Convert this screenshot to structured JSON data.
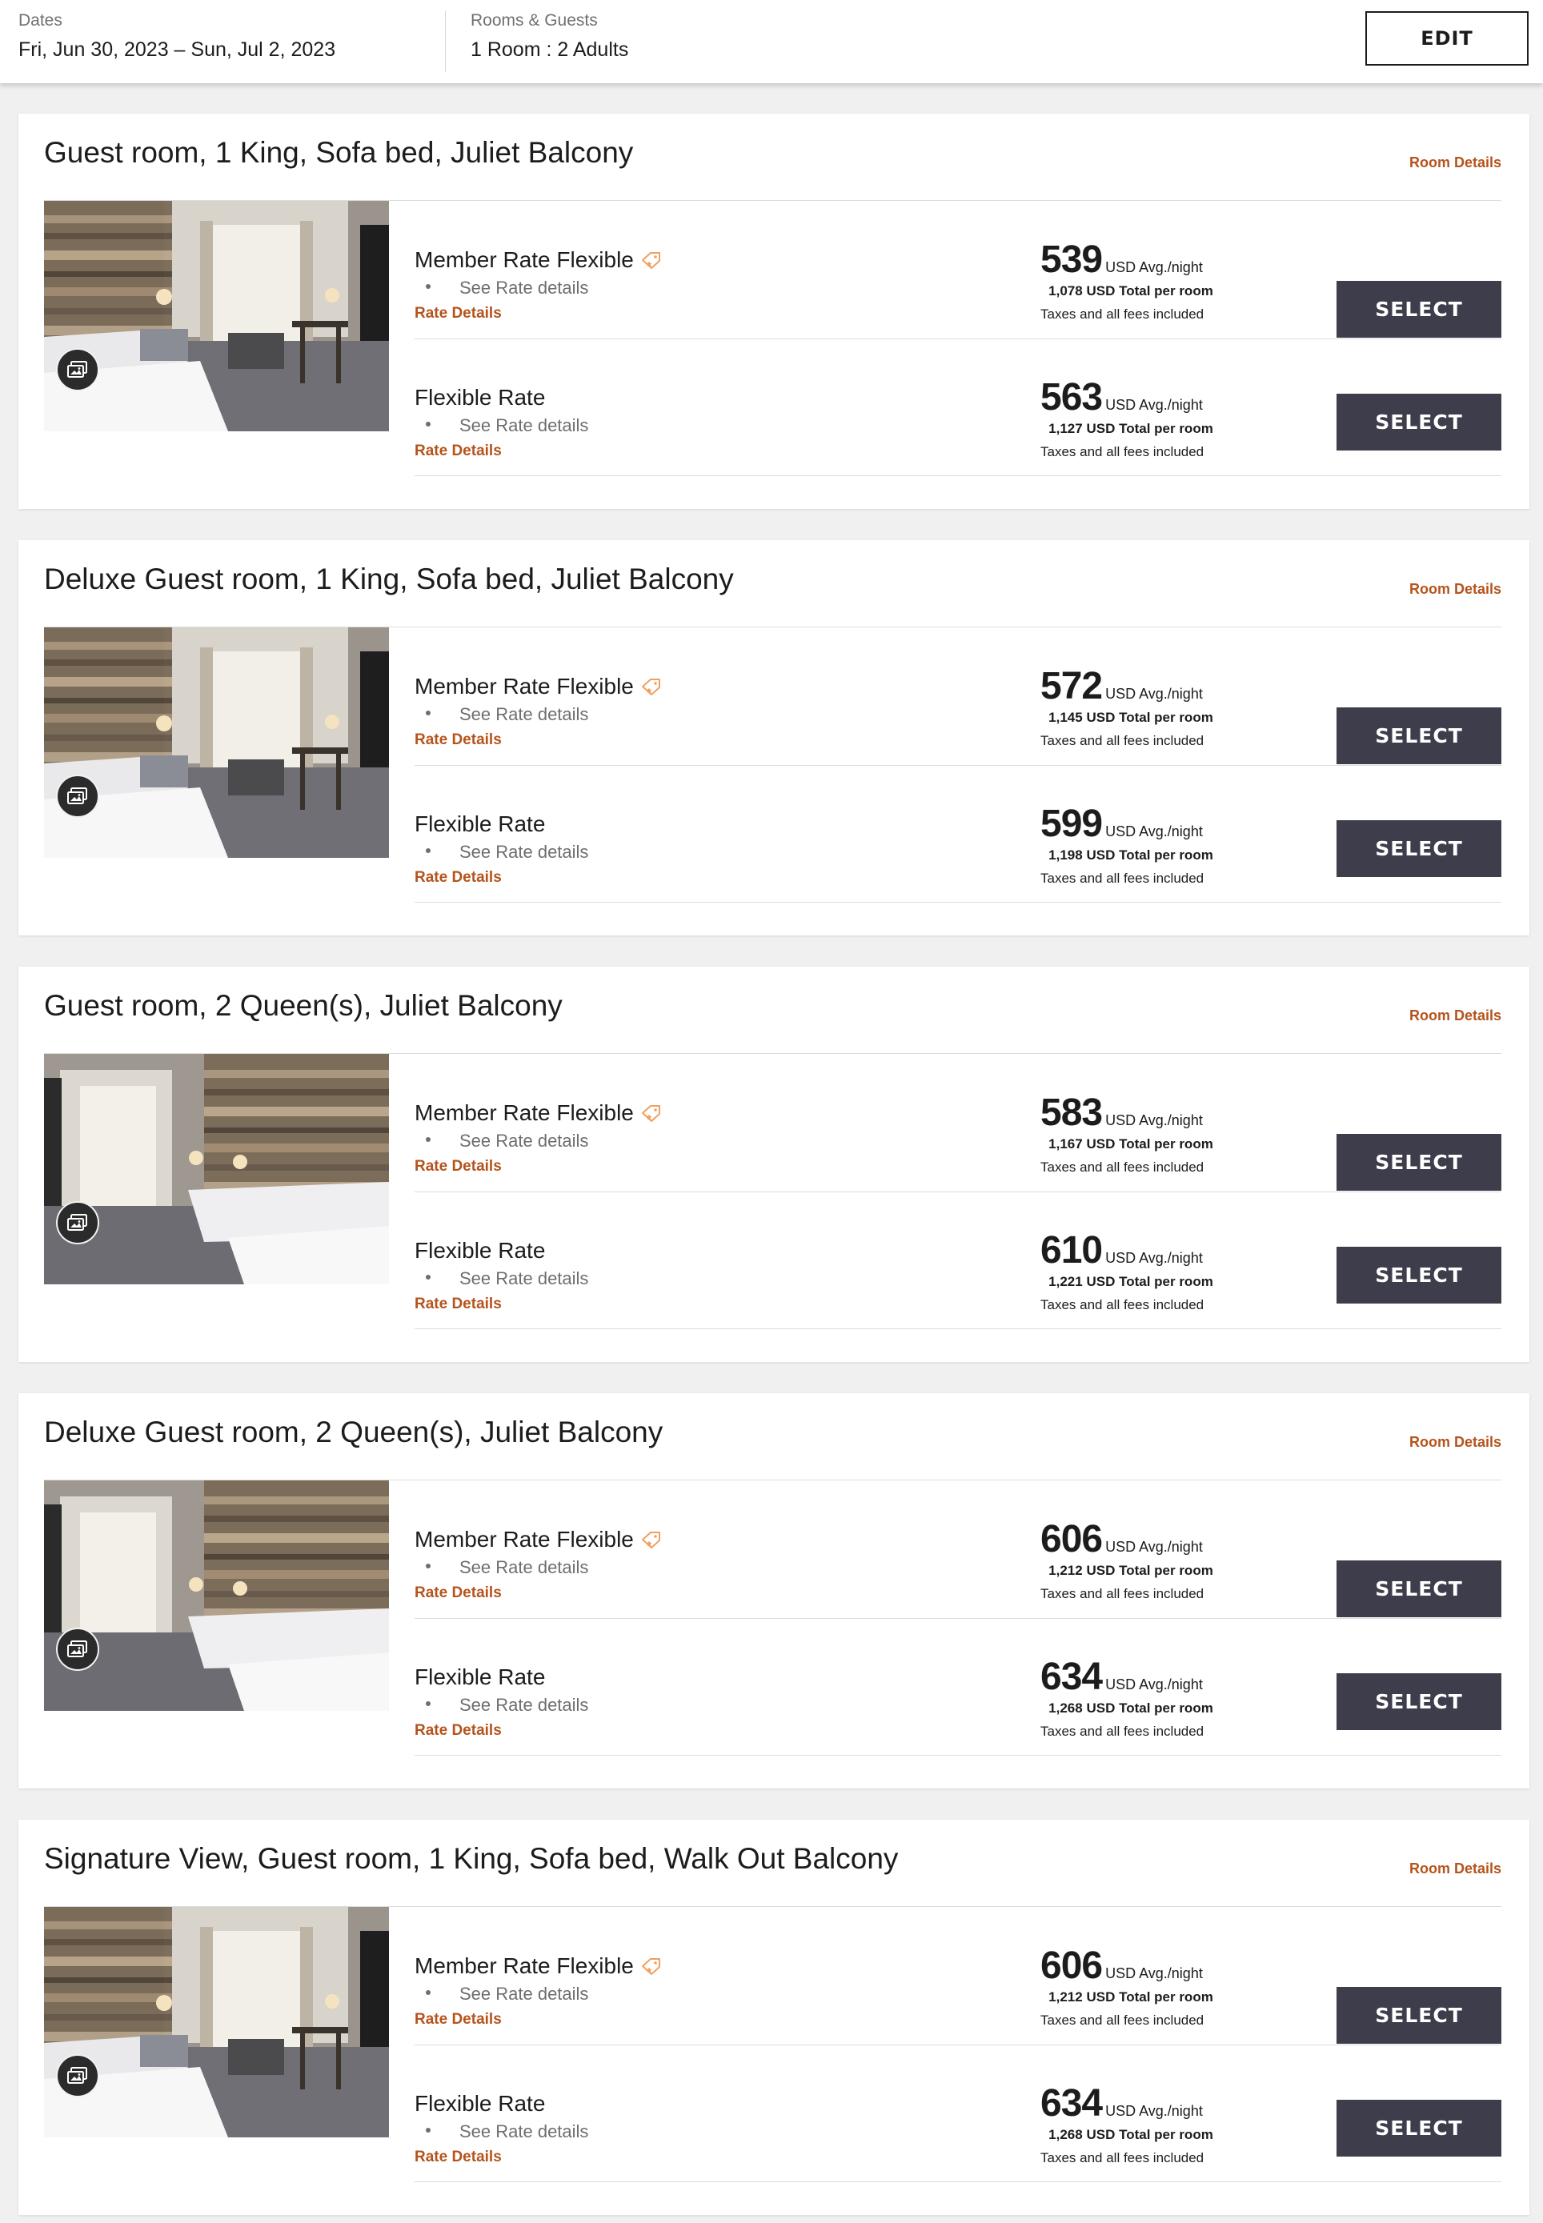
{
  "header": {
    "dates_label": "Dates",
    "dates_value": "Fri, Jun 30, 2023 – Sun, Jul 2, 2023",
    "rooms_label": "Rooms & Guests",
    "rooms_value": "1 Room : 2 Adults",
    "edit_label": "EDIT"
  },
  "common": {
    "room_details_label": "Room Details",
    "see_rate_details": "See Rate details",
    "rate_details_label": "Rate Details",
    "avg_night_label": "USD Avg./night",
    "total_suffix": "USD Total per room",
    "taxes_label": "Taxes and all fees included",
    "select_label": "SELECT"
  },
  "rooms": [
    {
      "title": "Guest room, 1 King, Sofa bed, Juliet Balcony",
      "photo": "king-room-photo",
      "rates": [
        {
          "name": "Member Rate Flexible",
          "member_tag": true,
          "price": "539",
          "total": "1,078"
        },
        {
          "name": "Flexible Rate",
          "member_tag": false,
          "price": "563",
          "total": "1,127"
        }
      ]
    },
    {
      "title": "Deluxe Guest room, 1 King, Sofa bed, Juliet Balcony",
      "photo": "king-room-photo",
      "rates": [
        {
          "name": "Member Rate Flexible",
          "member_tag": true,
          "price": "572",
          "total": "1,145"
        },
        {
          "name": "Flexible Rate",
          "member_tag": false,
          "price": "599",
          "total": "1,198"
        }
      ]
    },
    {
      "title": "Guest room, 2 Queen(s), Juliet Balcony",
      "photo": "queen-room-photo",
      "rates": [
        {
          "name": "Member Rate Flexible",
          "member_tag": true,
          "price": "583",
          "total": "1,167"
        },
        {
          "name": "Flexible Rate",
          "member_tag": false,
          "price": "610",
          "total": "1,221"
        }
      ]
    },
    {
      "title": "Deluxe Guest room, 2 Queen(s), Juliet Balcony",
      "photo": "queen-room-photo",
      "rates": [
        {
          "name": "Member Rate Flexible",
          "member_tag": true,
          "price": "606",
          "total": "1,212"
        },
        {
          "name": "Flexible Rate",
          "member_tag": false,
          "price": "634",
          "total": "1,268"
        }
      ]
    },
    {
      "title": "Signature View, Guest room, 1 King, Sofa bed, Walk Out Balcony",
      "photo": "king-room-photo",
      "rates": [
        {
          "name": "Member Rate Flexible",
          "member_tag": true,
          "price": "606",
          "total": "1,212"
        },
        {
          "name": "Flexible Rate",
          "member_tag": false,
          "price": "634",
          "total": "1,268"
        }
      ]
    }
  ],
  "colors": {
    "accent": "#b5531c",
    "select_button": "#3e3d4b",
    "member_tag": "#f0a060"
  }
}
